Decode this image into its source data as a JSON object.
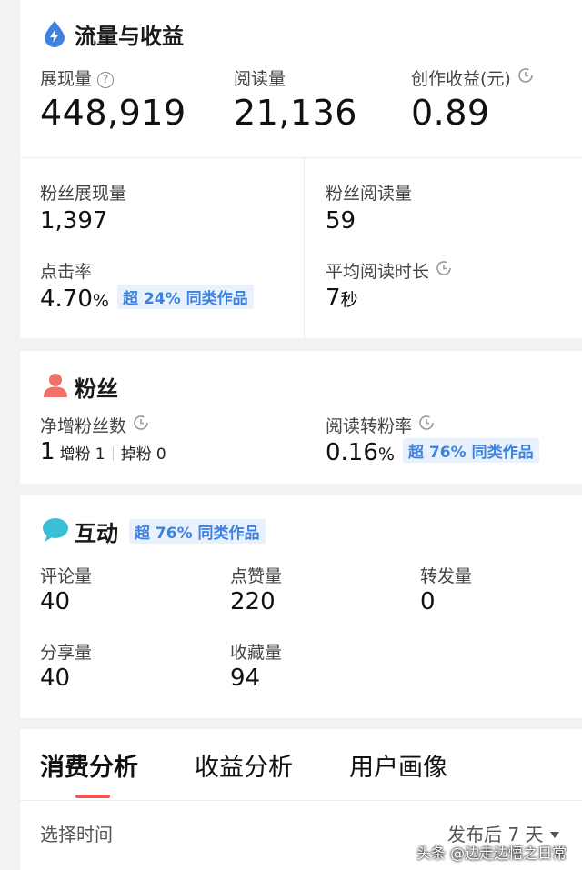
{
  "traffic": {
    "title": "流量与收益",
    "impressions": {
      "label": "展现量",
      "value": "448,919"
    },
    "reads": {
      "label": "阅读量",
      "value": "21,136"
    },
    "earnings": {
      "label": "创作收益(元)",
      "value": "0.89"
    },
    "fan_impressions": {
      "label": "粉丝展现量",
      "value": "1,397"
    },
    "fan_reads": {
      "label": "粉丝阅读量",
      "value": "59"
    },
    "ctr": {
      "label": "点击率",
      "value": "4.70",
      "unit": "%",
      "badge": "超 24% 同类作品"
    },
    "avg_read_time": {
      "label": "平均阅读时长",
      "value": "7",
      "unit": "秒"
    }
  },
  "fans": {
    "title": "粉丝",
    "net_gain": {
      "label": "净增粉丝数",
      "value": "1",
      "gain_label": "增粉",
      "gain_value": "1",
      "lost_label": "掉粉",
      "lost_value": "0"
    },
    "conversion": {
      "label": "阅读转粉率",
      "value": "0.16",
      "unit": "%",
      "badge": "超 76% 同类作品"
    }
  },
  "interaction": {
    "title": "互动",
    "badge": "超 76% 同类作品",
    "comments": {
      "label": "评论量",
      "value": "40"
    },
    "likes": {
      "label": "点赞量",
      "value": "220"
    },
    "reposts": {
      "label": "转发量",
      "value": "0"
    },
    "shares": {
      "label": "分享量",
      "value": "40"
    },
    "favorites": {
      "label": "收藏量",
      "value": "94"
    }
  },
  "tabs": [
    "消费分析",
    "收益分析",
    "用户画像"
  ],
  "time_select": {
    "label": "选择时间",
    "value": "发布后 7 天"
  },
  "watermark": "头条 @边走边悟之日常",
  "colors": {
    "accent": "#3d82de",
    "tab_active": "#f05454",
    "fans_icon": "#f0706a",
    "chat_icon": "#3bbfd6"
  }
}
